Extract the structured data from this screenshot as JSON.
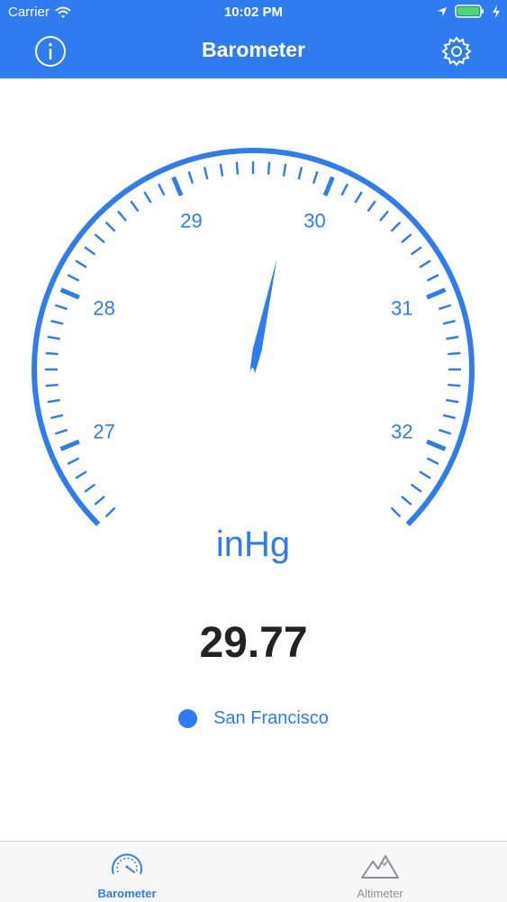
{
  "status_bar": {
    "carrier": "Carrier",
    "time": "10:02 PM"
  },
  "nav": {
    "title": "Barometer",
    "info_icon": "info-icon",
    "settings_icon": "gear-icon"
  },
  "gauge": {
    "unit": "inHg",
    "min": 26.5,
    "max": 32.5,
    "major_labels": [
      "27",
      "28",
      "29",
      "30",
      "31",
      "32"
    ],
    "needle_value": 29.77,
    "color": "#2f7cf0"
  },
  "reading": {
    "value": "29.77"
  },
  "location": {
    "name": "San Francisco"
  },
  "tabs": [
    {
      "label": "Barometer",
      "icon": "gauge-icon",
      "active": true
    },
    {
      "label": "Altimeter",
      "icon": "mountain-icon",
      "active": false
    }
  ],
  "colors": {
    "accent": "#2f7cf0",
    "inactive": "#8e8e93"
  }
}
